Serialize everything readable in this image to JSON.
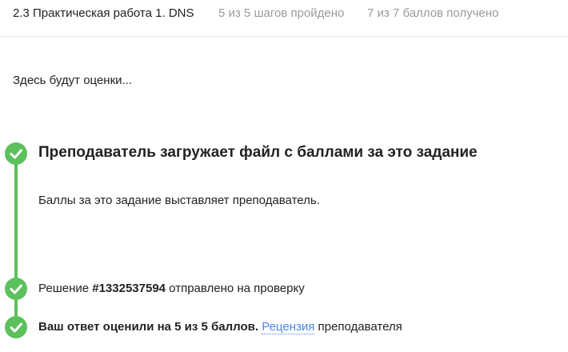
{
  "header": {
    "lesson_title": "2.3 Практическая работа 1. DNS",
    "steps_progress": "5 из 5 шагов пройдено",
    "points_progress": "7 из 7 баллов  получено"
  },
  "grades": {
    "placeholder": "Здесь будут оценки..."
  },
  "timeline": {
    "teacher_step": {
      "title": "Преподаватель загружает файл с баллами за это задание",
      "description": "Баллы за это задание выставляет преподаватель."
    },
    "submission_step": {
      "prefix": "Решение ",
      "submission_id": "#1332537594",
      "suffix": " отправлено на проверку"
    },
    "grade_step": {
      "result": "Ваш ответ оценили на 5 из 5 баллов.",
      "review_link": "Рецензия",
      "suffix": " преподавателя"
    }
  },
  "colors": {
    "success": "#5cc15c",
    "link": "#4a86e8",
    "muted": "#9a9a9a"
  },
  "icons": [
    "check-icon"
  ]
}
